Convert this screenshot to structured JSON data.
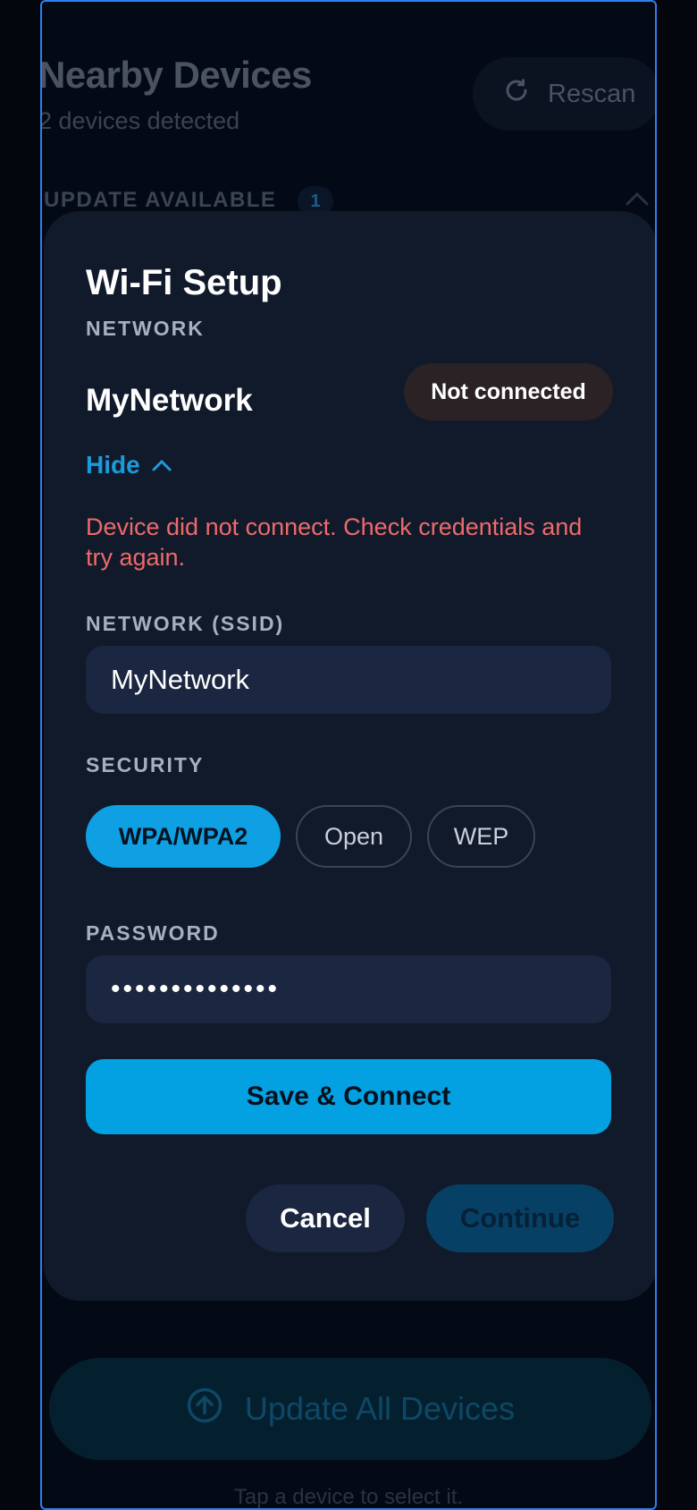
{
  "background": {
    "title": "Nearby Devices",
    "subtitle": "2 devices detected",
    "rescan_label": "Rescan",
    "section_label": "UPDATE AVAILABLE",
    "section_count": "1",
    "update_all_label": "Update All Devices",
    "hint": "Tap a device to select it."
  },
  "modal": {
    "title": "Wi-Fi Setup",
    "network_label": "NETWORK",
    "network_value": "MyNetwork",
    "status": "Not connected",
    "toggle_label": "Hide",
    "error": "Device did not connect. Check credentials and try again.",
    "ssid_label": "NETWORK (SSID)",
    "ssid_value": "MyNetwork",
    "security_label": "SECURITY",
    "security_options": [
      "WPA/WPA2",
      "Open",
      "WEP"
    ],
    "security_selected": "WPA/WPA2",
    "password_label": "PASSWORD",
    "password_value": "••••••••••••••",
    "save_label": "Save & Connect",
    "cancel_label": "Cancel",
    "continue_label": "Continue"
  },
  "colors": {
    "accent": "#03a0e2",
    "error": "#ee6a6a",
    "modal_bg": "#111a2b",
    "page_bg": "#03060c"
  }
}
